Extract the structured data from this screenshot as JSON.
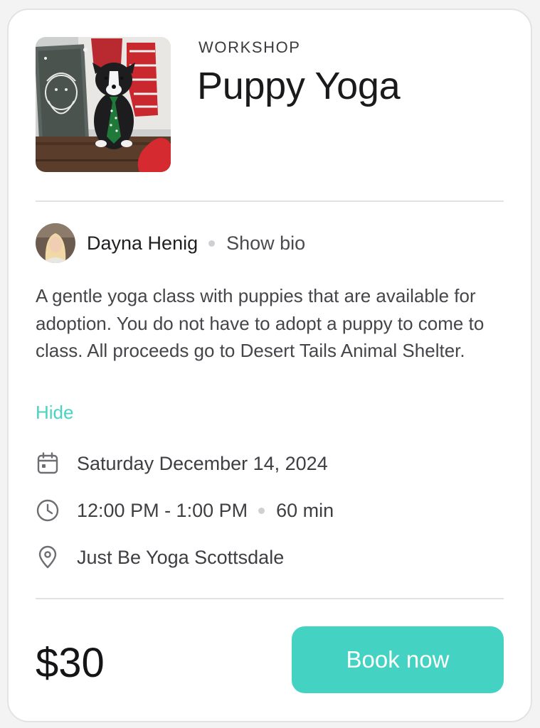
{
  "event": {
    "category": "WORKSHOP",
    "title": "Puppy Yoga",
    "image_icon": "event-photo-puppy"
  },
  "instructor": {
    "name": "Dayna Henig",
    "show_bio_label": "Show bio",
    "avatar_icon": "avatar"
  },
  "description": {
    "text": "A gentle yoga class with puppies that are available for adoption. You do not have to adopt a puppy to come to class. All proceeds go to Desert Tails Animal Shelter.",
    "toggle_label": "Hide"
  },
  "details": {
    "date": "Saturday December 14, 2024",
    "date_icon": "calendar-icon",
    "time": "12:00 PM - 1:00 PM",
    "duration": "60 min",
    "time_icon": "clock-icon",
    "location": "Just Be Yoga Scottsdale",
    "location_icon": "location-pin-icon"
  },
  "footer": {
    "price": "$30",
    "book_label": "Book now"
  },
  "colors": {
    "accent": "#44d3c3",
    "link": "#4cd2c2",
    "divider": "#e2e2e5",
    "text_primary": "#1a1a1c",
    "text_secondary": "#45454a"
  }
}
